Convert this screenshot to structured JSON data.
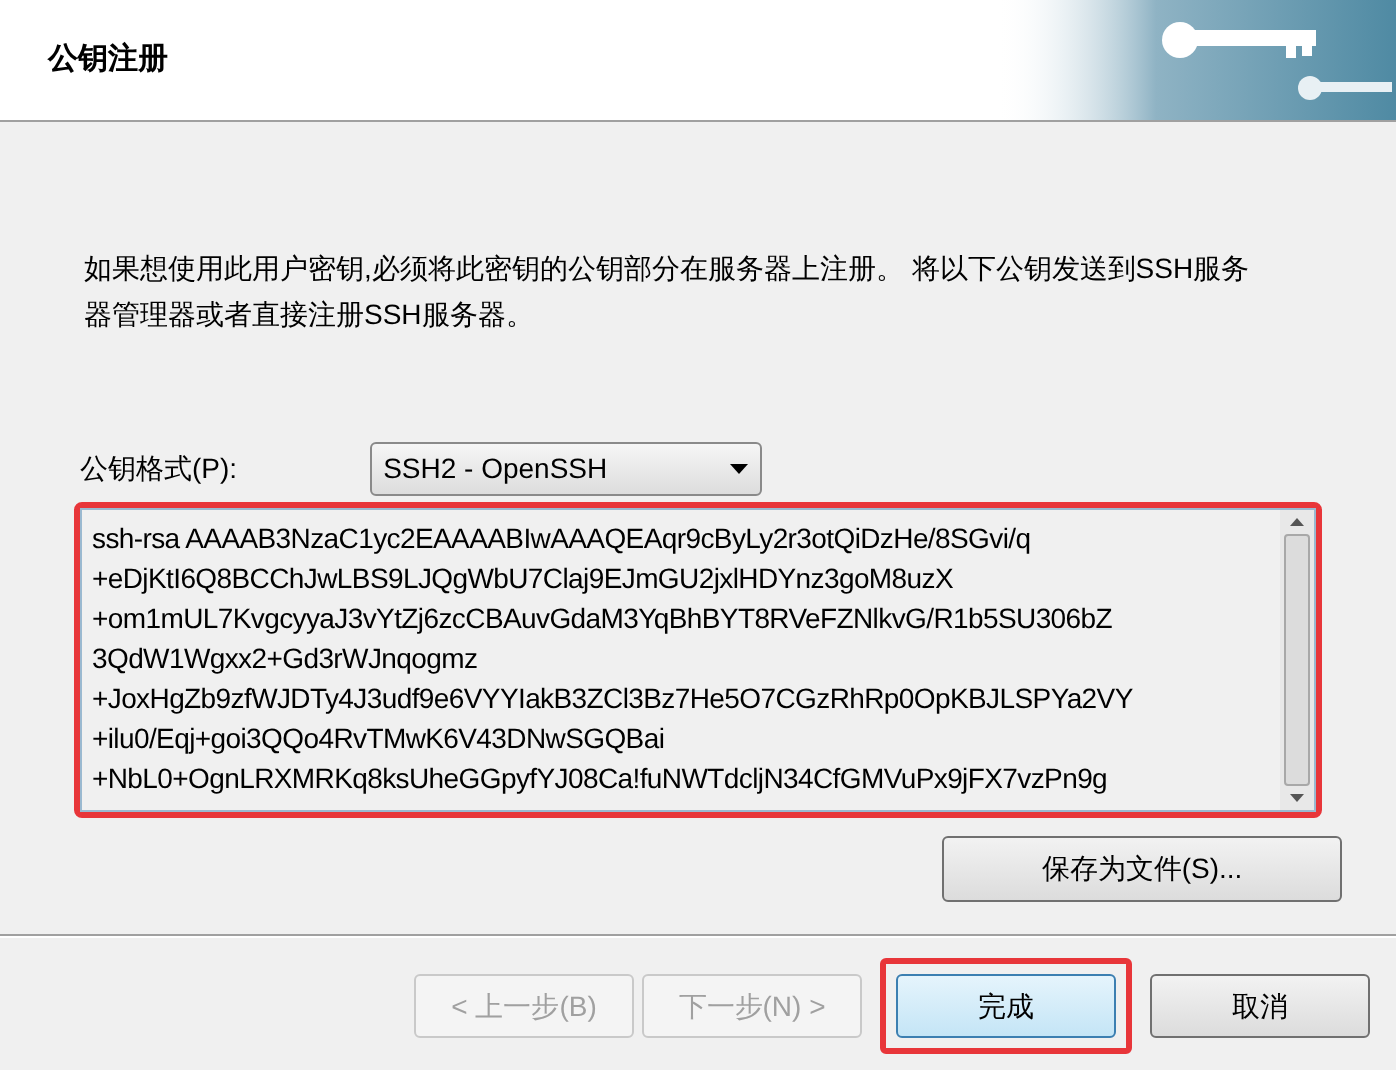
{
  "header": {
    "title": "公钥注册"
  },
  "description": "如果想使用此用户密钥,必须将此密钥的公钥部分在服务器上注册。 将以下公钥发送到SSH服务器管理器或者直接注册SSH服务器。",
  "format": {
    "label": "公钥格式(P):",
    "value": "SSH2 - OpenSSH"
  },
  "key_lines": [
    "ssh-rsa AAAAB3NzaC1yc2EAAAABIwAAAQEAqr9cByLy2r3otQiDzHe/8SGvi/q",
    "+eDjKtI6Q8BCChJwLBS9LJQgWbU7Claj9EJmGU2jxlHDYnz3goM8uzX",
    "+om1mUL7KvgcyyaJ3vYtZj6zcCBAuvGdaM3YqBhBYT8RVeFZNlkvG/R1b5SU306bZ",
    "3QdW1Wgxx2+Gd3rWJnqogmz",
    "+JoxHgZb9zfWJDTy4J3udf9e6VYYIakB3ZCl3Bz7He5O7CGzRhRp0OpKBJLSPYa2VY",
    "+ilu0/Eqj+goi3QQo4RvTMwK6V43DNwSGQBai",
    "+NbL0+OgnLRXMRKq8ksUheGGpyfYJ08Ca!fuNWTdcljN34CfGMVuPx9jFX7vzPn9g"
  ],
  "save_button": "保存为文件(S)...",
  "buttons": [
    {
      "label": "< 上一步(B)",
      "disabled": true,
      "default": false
    },
    {
      "label": "下一步(N) >",
      "disabled": true,
      "default": false
    },
    {
      "label": "完成",
      "disabled": false,
      "default": true
    },
    {
      "label": "取消",
      "disabled": false,
      "default": false
    }
  ]
}
